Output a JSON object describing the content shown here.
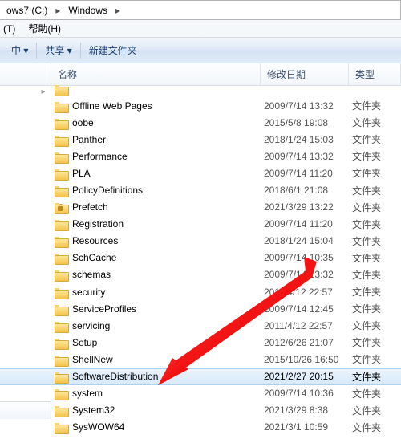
{
  "breadcrumb": {
    "seg1": "ows7 (C:)",
    "seg2": "Windows"
  },
  "menubar": {
    "edit": "(T)",
    "help": "帮助(H)"
  },
  "toolbar": {
    "include": "中 ▾",
    "share": "共享 ▾",
    "newfolder": "新建文件夹"
  },
  "columns": {
    "name": "名称",
    "date": "修改日期",
    "type": "类型"
  },
  "rows": [
    {
      "name": "",
      "date": "",
      "type": "",
      "partial": true
    },
    {
      "name": "Offline Web Pages",
      "date": "2009/7/14 13:32",
      "type": "文件夹"
    },
    {
      "name": "oobe",
      "date": "2015/5/8 19:08",
      "type": "文件夹"
    },
    {
      "name": "Panther",
      "date": "2018/1/24 15:03",
      "type": "文件夹"
    },
    {
      "name": "Performance",
      "date": "2009/7/14 13:32",
      "type": "文件夹"
    },
    {
      "name": "PLA",
      "date": "2009/7/14 11:20",
      "type": "文件夹"
    },
    {
      "name": "PolicyDefinitions",
      "date": "2018/6/1 21:08",
      "type": "文件夹"
    },
    {
      "name": "Prefetch",
      "date": "2021/3/29 13:22",
      "type": "文件夹",
      "lock": true
    },
    {
      "name": "Registration",
      "date": "2009/7/14 11:20",
      "type": "文件夹"
    },
    {
      "name": "Resources",
      "date": "2018/1/24 15:04",
      "type": "文件夹"
    },
    {
      "name": "SchCache",
      "date": "2009/7/14 10:35",
      "type": "文件夹"
    },
    {
      "name": "schemas",
      "date": "2009/7/14 13:32",
      "type": "文件夹"
    },
    {
      "name": "security",
      "date": "2011/4/12 22:57",
      "type": "文件夹"
    },
    {
      "name": "ServiceProfiles",
      "date": "2009/7/14 12:45",
      "type": "文件夹"
    },
    {
      "name": "servicing",
      "date": "2011/4/12 22:57",
      "type": "文件夹"
    },
    {
      "name": "Setup",
      "date": "2012/6/26 21:07",
      "type": "文件夹"
    },
    {
      "name": "ShellNew",
      "date": "2015/10/26 16:50",
      "type": "文件夹"
    },
    {
      "name": "SoftwareDistribution",
      "date": "2021/2/27 20:15",
      "type": "文件夹",
      "selected": true
    },
    {
      "name": "system",
      "date": "2009/7/14 10:36",
      "type": "文件夹"
    },
    {
      "name": "System32",
      "date": "2021/3/29 8:38",
      "type": "文件夹"
    },
    {
      "name": "SysWOW64",
      "date": "2021/3/1 10:59",
      "type": "文件夹"
    }
  ]
}
